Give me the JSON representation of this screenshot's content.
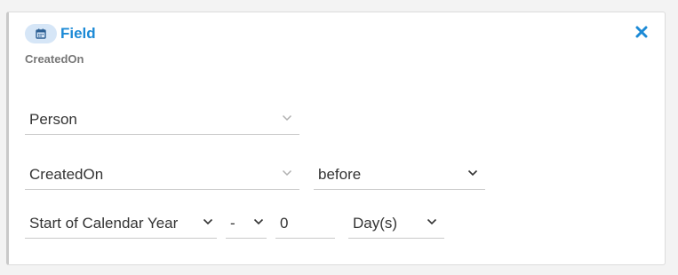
{
  "card": {
    "title": "Field",
    "subtitle": "CreatedOn",
    "header_icon": "calendar-icon",
    "close_icon": "close-icon"
  },
  "row1": {
    "entity": "Person"
  },
  "row2": {
    "field": "CreatedOn",
    "operator": "before"
  },
  "row3": {
    "anchor": "Start of Calendar Year",
    "sign": "-",
    "amount": "0",
    "unit": "Day(s)"
  },
  "colors": {
    "accent": "#1c8ad6",
    "pill_bg": "#d6e6f7",
    "text": "#333333",
    "muted": "#777777"
  }
}
